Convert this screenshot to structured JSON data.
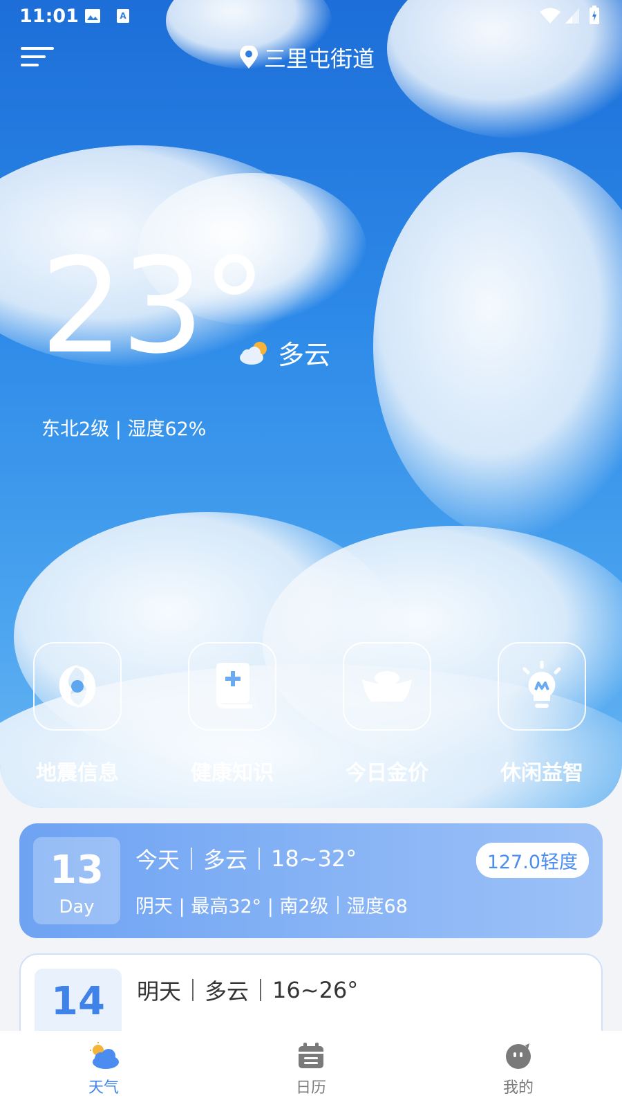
{
  "status_bar": {
    "time": "11:01"
  },
  "header": {
    "location": "三里屯街道"
  },
  "current": {
    "temperature": "23°",
    "condition": "多云",
    "wind_humidity": "东北2级 | 湿度62%"
  },
  "quick_links": [
    {
      "label": "地震信息",
      "icon": "typhoon-icon"
    },
    {
      "label": "健康知识",
      "icon": "health-book-icon"
    },
    {
      "label": "今日金价",
      "icon": "gold-ingot-icon"
    },
    {
      "label": "休闲益智",
      "icon": "lightbulb-icon"
    }
  ],
  "forecast": [
    {
      "day_num": "13",
      "day_sub": "Day",
      "day_label": "今天",
      "condition": "多云",
      "temp_range": "18~32°",
      "aqi": "127.0轻度",
      "detail_weather": "阴天 | 最高32° | 南2级",
      "detail_humidity": "湿度68"
    },
    {
      "day_num": "14",
      "day_label": "明天",
      "condition": "多云",
      "temp_range": "16~26°"
    }
  ],
  "tabs": [
    {
      "label": "天气",
      "icon": "weather-icon",
      "active": true
    },
    {
      "label": "日历",
      "icon": "calendar-icon",
      "active": false
    },
    {
      "label": "我的",
      "icon": "profile-icon",
      "active": false
    }
  ],
  "colors": {
    "accent": "#3f82e8",
    "inactive": "#7a7a7a",
    "sky": "#2d8ae8"
  }
}
